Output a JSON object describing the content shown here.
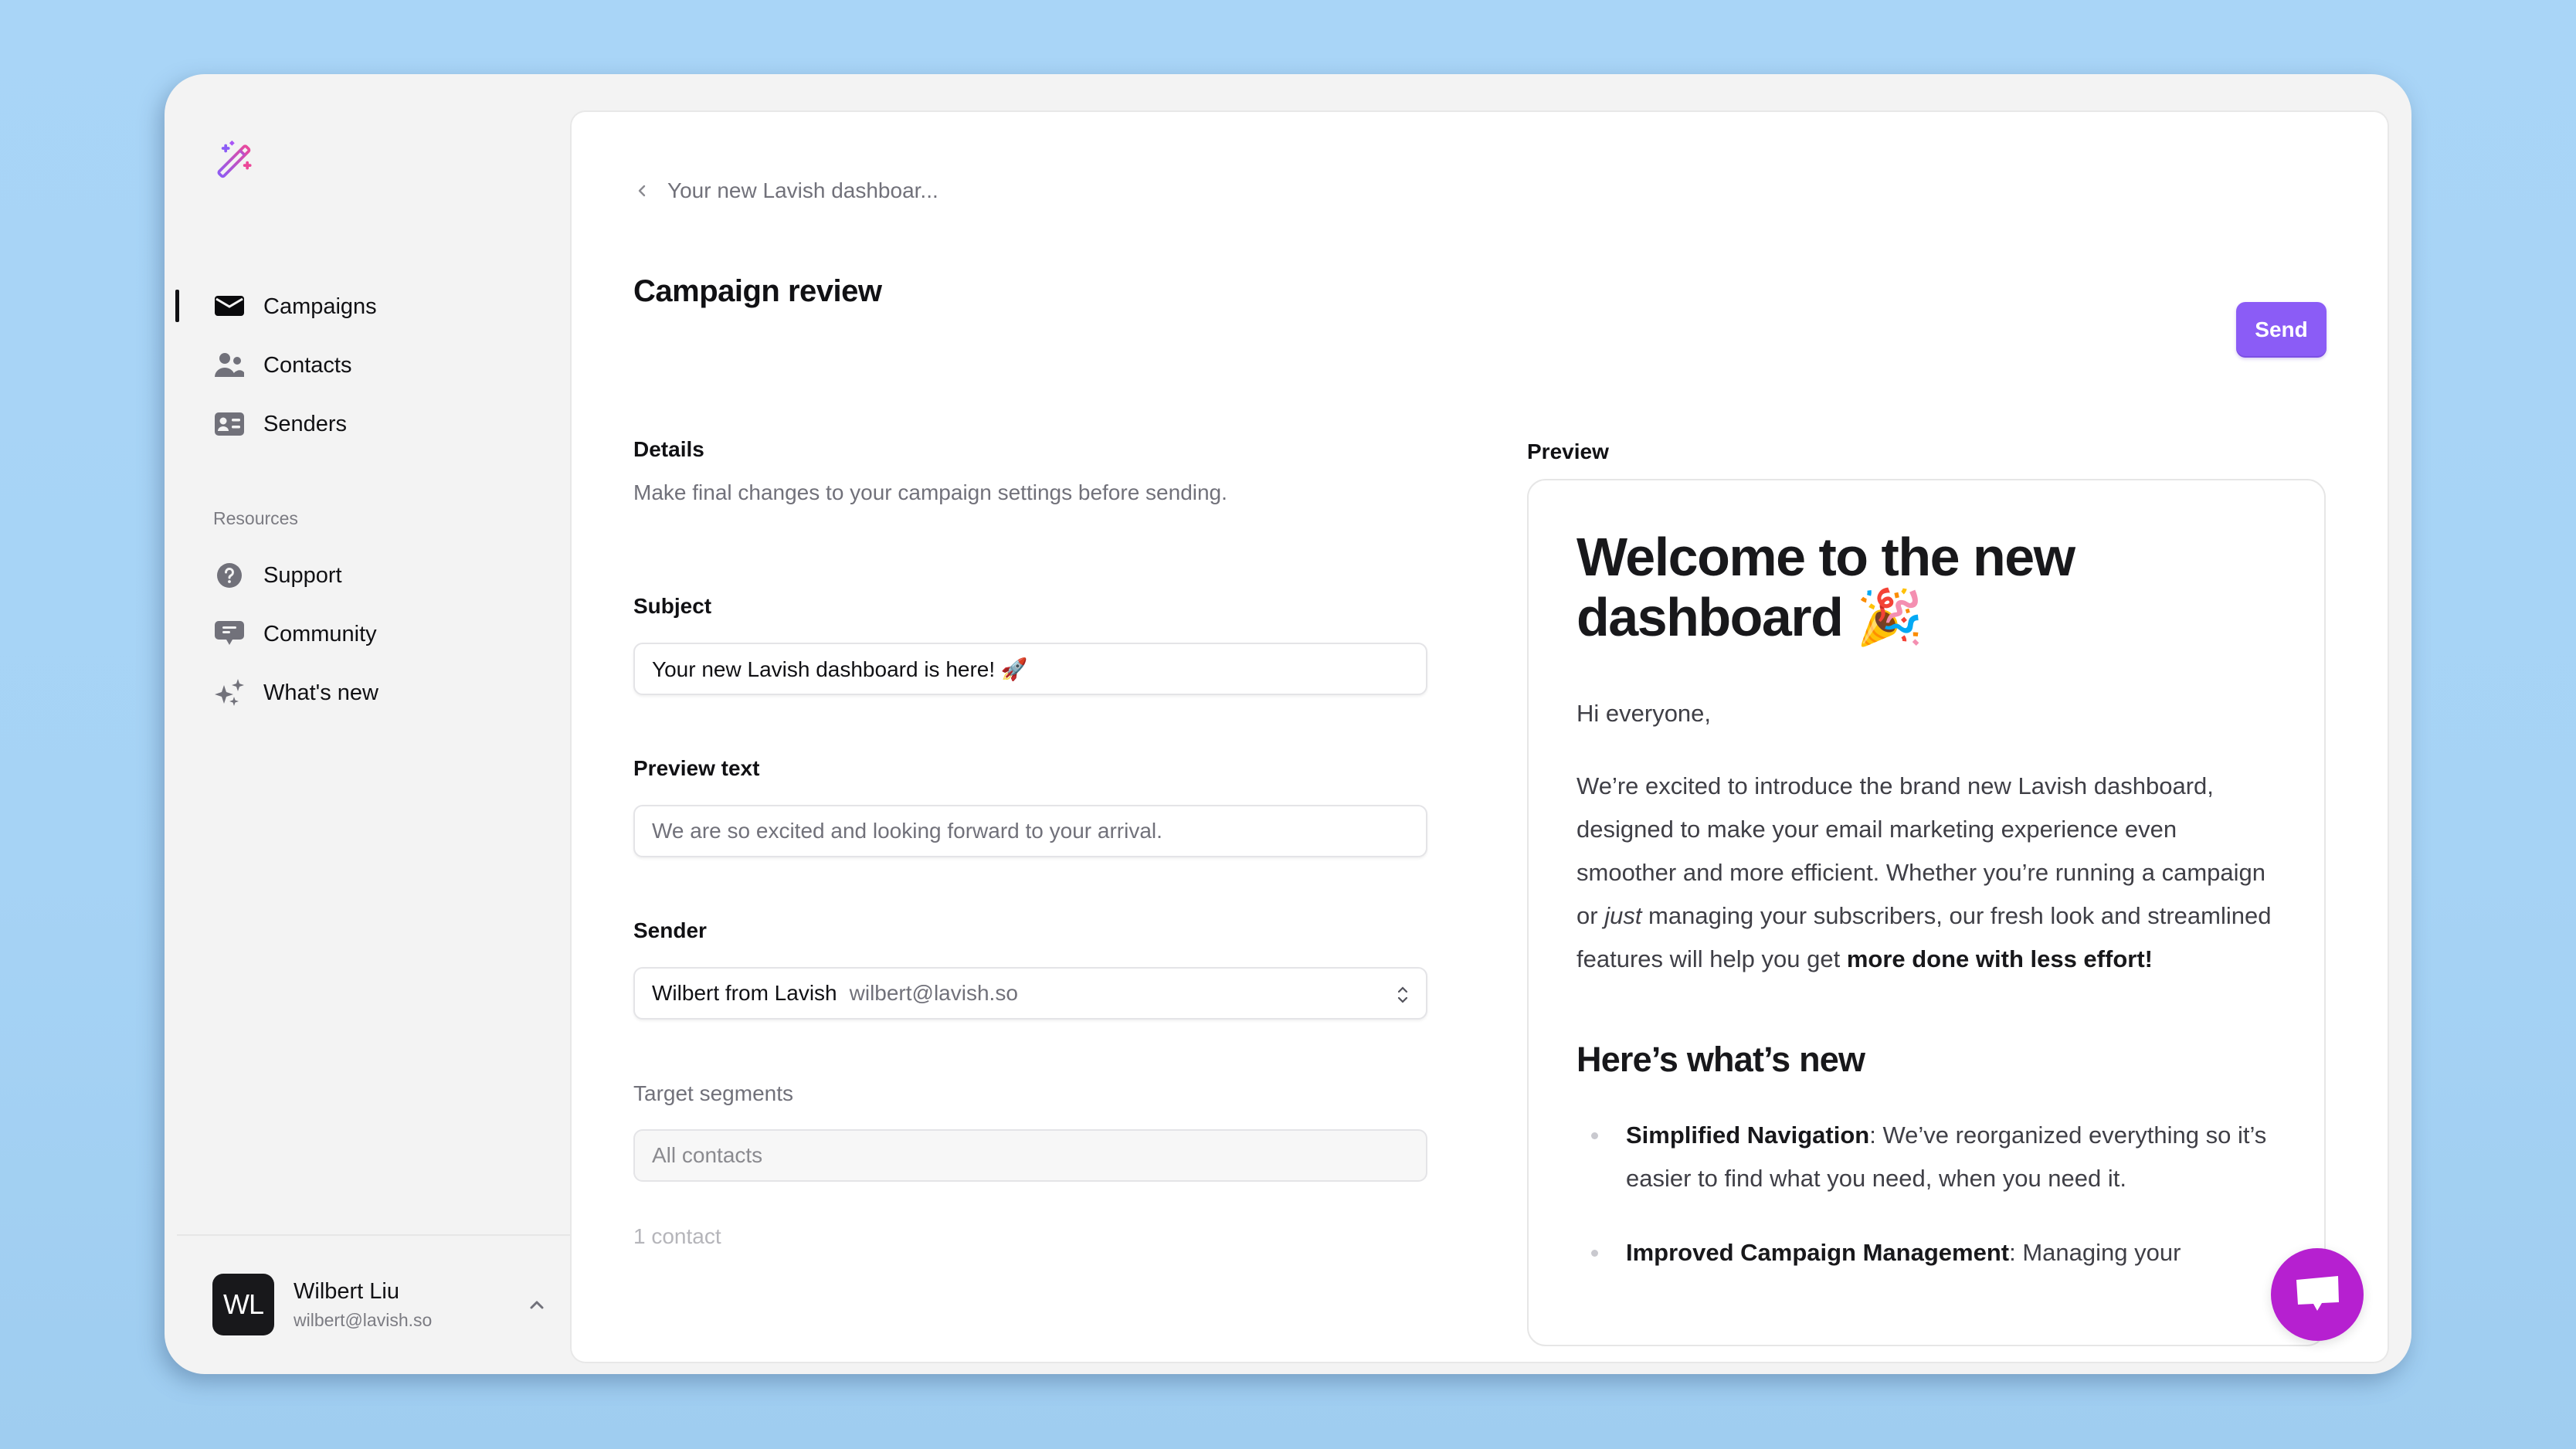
{
  "sidebar": {
    "logo": "magic-wand-logo",
    "nav": [
      {
        "label": "Campaigns",
        "icon": "envelope-icon",
        "active": true
      },
      {
        "label": "Contacts",
        "icon": "users-icon",
        "active": false
      },
      {
        "label": "Senders",
        "icon": "id-card-icon",
        "active": false
      }
    ],
    "resources_label": "Resources",
    "resources": [
      {
        "label": "Support",
        "icon": "question-circle-icon"
      },
      {
        "label": "Community",
        "icon": "chat-bubble-icon"
      },
      {
        "label": "What's new",
        "icon": "sparkles-icon"
      }
    ],
    "user": {
      "initials": "WL",
      "name": "Wilbert Liu",
      "email": "wilbert@lavish.so"
    }
  },
  "main": {
    "breadcrumb": "Your new Lavish dashboar...",
    "title": "Campaign review",
    "send_label": "Send",
    "details": {
      "heading": "Details",
      "subtitle": "Make final changes to your campaign settings before sending.",
      "subject_label": "Subject",
      "subject_value": "Your new Lavish dashboard is here! 🚀",
      "preview_text_label": "Preview text",
      "preview_text_value": "We are so excited and looking forward to your arrival.",
      "sender_label": "Sender",
      "sender_name": "Wilbert from Lavish",
      "sender_email": "wilbert@lavish.so",
      "target_label": "Target segments",
      "target_value": "All contacts",
      "contact_count": "1 contact"
    },
    "preview": {
      "label": "Preview",
      "heading_line1": "Welcome to the new",
      "heading_line2": "dashboard 🎉",
      "greeting": "Hi everyone,",
      "body_part1": "We’re excited to introduce the brand new Lavish dashboard, designed to make your email marketing experience even smoother and more efficient. Whether you’re running a campaign or ",
      "body_italic": "just",
      "body_part2": " managing your subscribers, our fresh look and streamlined features will help you get ",
      "body_bold": "more done with less effort!",
      "section_heading": "Here’s what’s new",
      "features": [
        {
          "title": "Simplified Navigation",
          "text": ": We’ve reorganized everything so it’s easier to find what you need, when you need it."
        },
        {
          "title": "Improved Campaign Management",
          "text": ": Managing your"
        }
      ]
    }
  },
  "colors": {
    "accent": "#8b5cf6",
    "chat_widget": "#b620d0",
    "background": "#a9d5f7"
  }
}
